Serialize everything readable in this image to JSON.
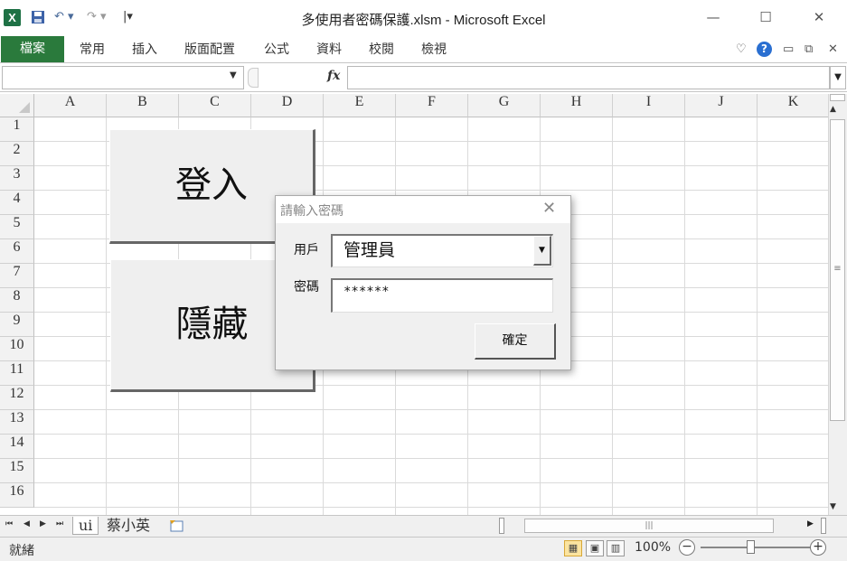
{
  "window": {
    "title": "多使用者密碼保護.xlsm - Microsoft Excel",
    "app_icon": "X",
    "controls": [
      "—",
      "☐",
      "✕"
    ]
  },
  "ribbon": {
    "file_tab": "檔案",
    "tabs": [
      "常用",
      "插入",
      "版面配置",
      "公式",
      "資料",
      "校閱",
      "檢視"
    ]
  },
  "formula_bar": {
    "fx_label": "fx",
    "name_box": "",
    "formula": ""
  },
  "columns": [
    "A",
    "B",
    "C",
    "D",
    "E",
    "F",
    "G",
    "H",
    "I",
    "J",
    "K"
  ],
  "rows": [
    "1",
    "2",
    "3",
    "4",
    "5",
    "6",
    "7",
    "8",
    "9",
    "10",
    "11",
    "12",
    "13",
    "14",
    "15",
    "16"
  ],
  "sheet_buttons": {
    "login": "登入",
    "hide": "隱藏"
  },
  "sheet_tabs": [
    "ui",
    "蔡小英"
  ],
  "status_bar": {
    "ready": "就緒",
    "zoom": "100%"
  },
  "dialog": {
    "title": "請輸入密碼",
    "user_label": "用戶",
    "user_value": "管理員",
    "password_label": "密碼",
    "password_value": "******",
    "ok_label": "確定"
  },
  "colors": {
    "file_tab_bg": "#2a7a3c",
    "excel_green": "#1e7145",
    "help_blue": "#2a6fd1"
  }
}
